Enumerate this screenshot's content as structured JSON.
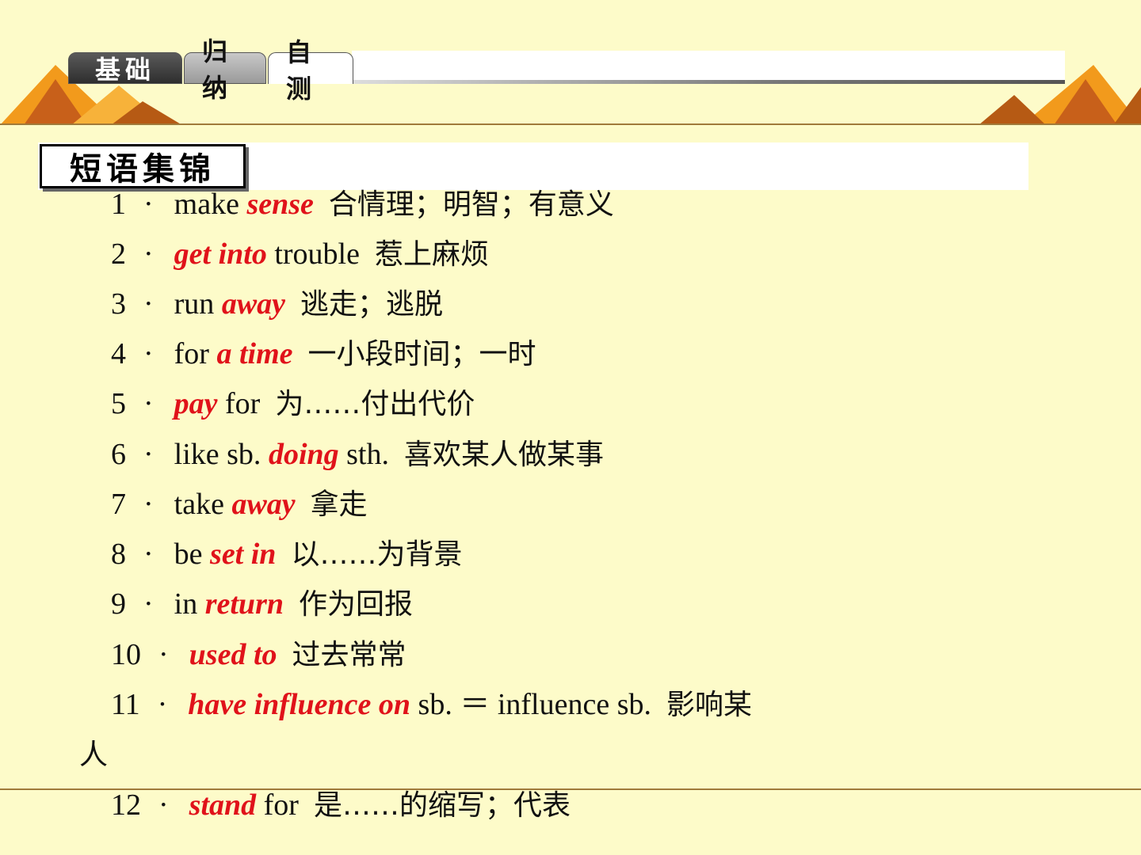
{
  "tabs": [
    {
      "label": "基础",
      "state": "dark"
    },
    {
      "label": "归纳",
      "state": "mid"
    },
    {
      "label": "自测",
      "state": "active"
    }
  ],
  "section_title": "短语集锦",
  "items": [
    {
      "num": "1",
      "pre": "make ",
      "key": "sense",
      "post": "",
      "cn": "合情理；明智；有意义"
    },
    {
      "num": "2",
      "pre": "",
      "key": "get into",
      "post": " trouble",
      "cn": "惹上麻烦"
    },
    {
      "num": "3",
      "pre": "run ",
      "key": "away",
      "post": "",
      "cn": "逃走；逃脱"
    },
    {
      "num": "4",
      "pre": "for ",
      "key": "a time",
      "post": "",
      "cn": "一小段时间；一时"
    },
    {
      "num": "5",
      "pre": "",
      "key": "pay",
      "post": " for",
      "cn": "为……付出代价"
    },
    {
      "num": "6",
      "pre": "like sb. ",
      "key": "doing",
      "post": " sth.",
      "cn": "喜欢某人做某事"
    },
    {
      "num": "7",
      "pre": "take ",
      "key": "away",
      "post": "",
      "cn": "拿走"
    },
    {
      "num": "8",
      "pre": "be ",
      "key": "set in",
      "post": "",
      "cn": "以……为背景"
    },
    {
      "num": "9",
      "pre": "in ",
      "key": "return",
      "post": "",
      "cn": "作为回报"
    },
    {
      "num": "10",
      "pre": "",
      "key": "used to",
      "post": "",
      "cn": "过去常常"
    },
    {
      "num": "11",
      "pre": "",
      "key": "have influence on",
      "post": " sb. ＝ influence sb.",
      "cn": "影响某"
    },
    {
      "num": "12",
      "pre": "",
      "key": "stand",
      "post": " for",
      "cn": "是……的缩写；代表"
    }
  ],
  "item11_wrap": "人",
  "colors": {
    "background": "#fdfbc9",
    "keyword": "#e0121a",
    "rule": "#a07a3a"
  }
}
